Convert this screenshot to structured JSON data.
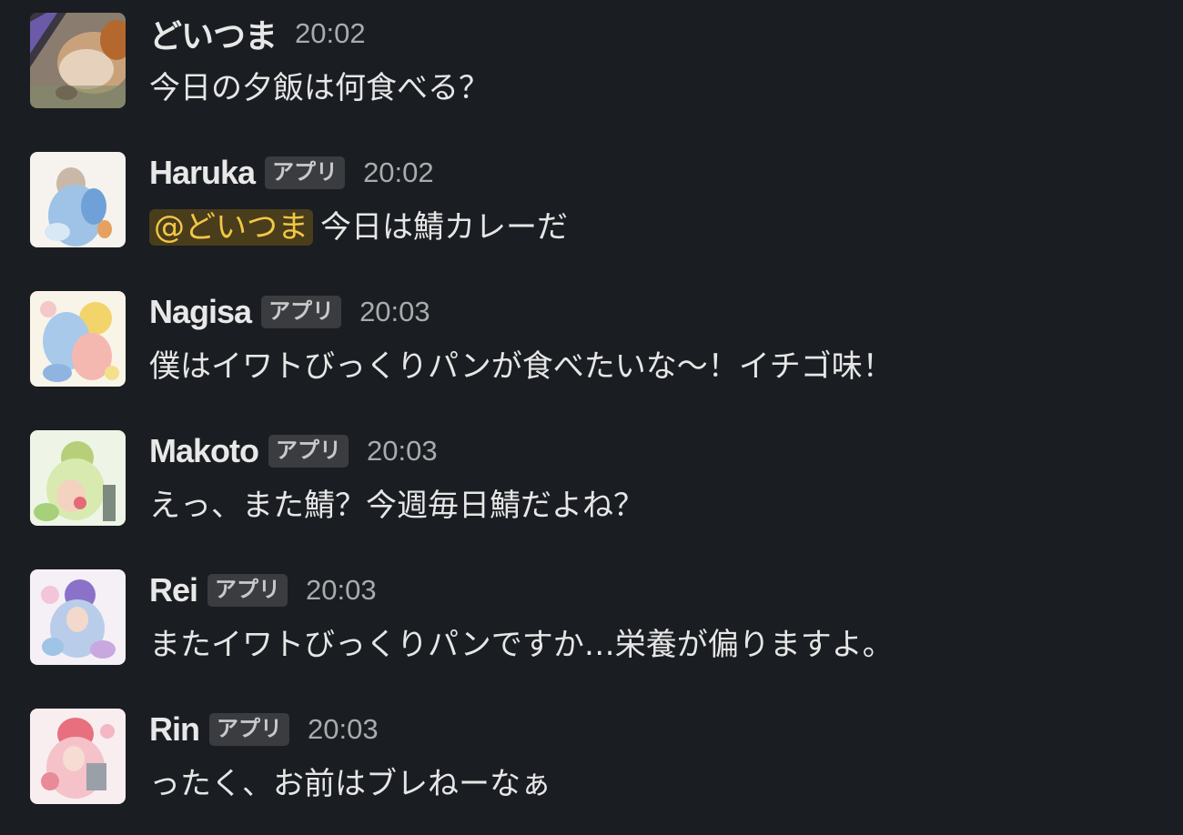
{
  "messages": [
    {
      "user": "どいつま",
      "badge": "",
      "time": "20:02",
      "mention": "",
      "text": "今日の夕飯は何食べる？",
      "avatar": "dog-photo"
    },
    {
      "user": "Haruka",
      "badge": "アプリ",
      "time": "20:02",
      "mention": "@どいつま",
      "text": "今日は鯖カレーだ",
      "avatar": "illustration-blue"
    },
    {
      "user": "Nagisa",
      "badge": "アプリ",
      "time": "20:03",
      "mention": "",
      "text": "僕はイワトびっくりパンが食べたいな〜！イチゴ味！",
      "avatar": "illustration-yellow"
    },
    {
      "user": "Makoto",
      "badge": "アプリ",
      "time": "20:03",
      "mention": "",
      "text": "えっ、また鯖？今週毎日鯖だよね？",
      "avatar": "illustration-green"
    },
    {
      "user": "Rei",
      "badge": "アプリ",
      "time": "20:03",
      "mention": "",
      "text": "またイワトびっくりパンですか…栄養が偏りますよ。",
      "avatar": "illustration-purple"
    },
    {
      "user": "Rin",
      "badge": "アプリ",
      "time": "20:03",
      "mention": "",
      "text": "ったく、お前はブレねーなぁ",
      "avatar": "illustration-pink"
    }
  ],
  "colors": {
    "background": "#1a1d21",
    "mention_bg": "#4a3d1c",
    "mention_fg": "#f2c744",
    "badge_bg": "#3a3c40"
  }
}
